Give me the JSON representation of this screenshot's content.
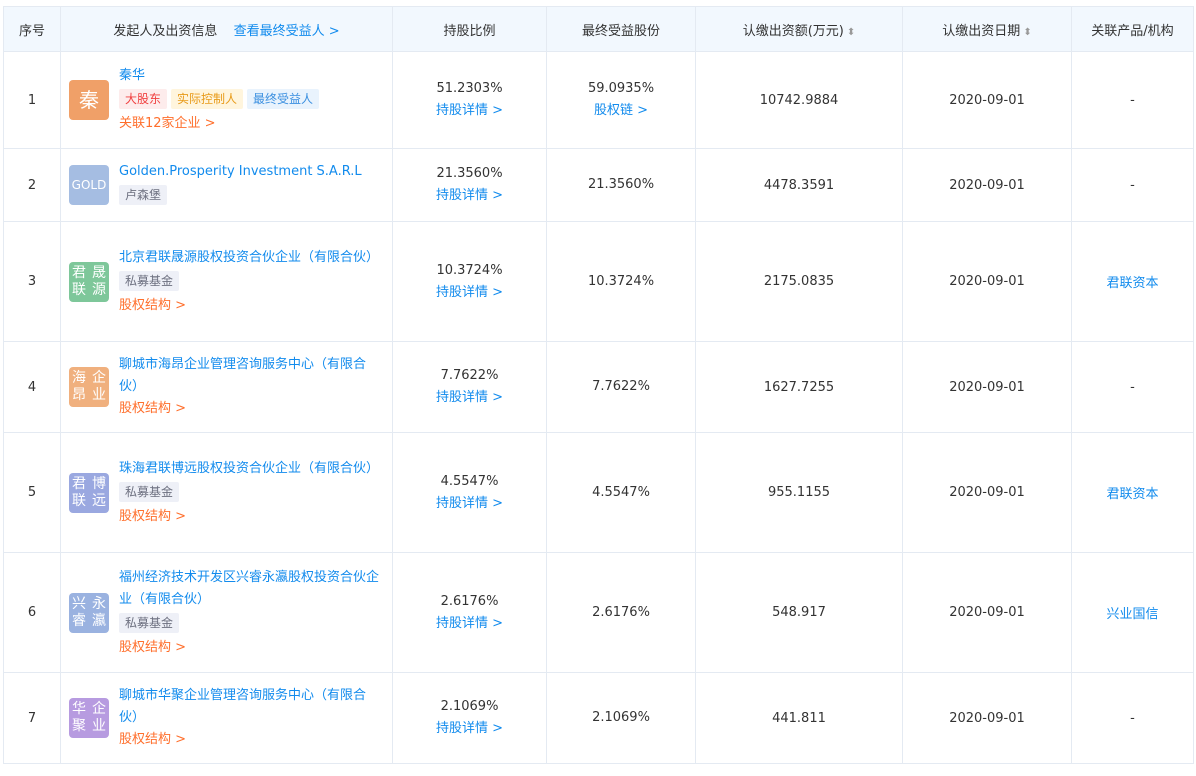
{
  "header": {
    "seq": "序号",
    "party": "发起人及出资信息",
    "view_beneficiary": "查看最终受益人 >",
    "ratio": "持股比例",
    "final_benefit": "最终受益股份",
    "amount": "认缴出资额(万元)",
    "date": "认缴出资日期",
    "related": "关联产品/机构"
  },
  "colors": {
    "link": "#128bed",
    "accent": "#ff6f2c",
    "header_bg": "#f2f8fe"
  },
  "rows": [
    {
      "seq": "1",
      "logo_text": "秦",
      "logo_color": "#f0a068",
      "name": "秦华",
      "tags": [
        {
          "text": "大股东",
          "style": "red"
        },
        {
          "text": "实际控制人",
          "style": "yellow"
        },
        {
          "text": "最终受益人",
          "style": "blue"
        }
      ],
      "extra_link": "关联12家企业 >",
      "ratio": "51.2303%",
      "ratio_link": "持股详情 >",
      "final_benefit": "59.0935%",
      "final_link": "股权链 >",
      "amount": "10742.9884",
      "date": "2020-09-01",
      "related": "-",
      "related_is_link": false
    },
    {
      "seq": "2",
      "logo_text": "GO LD",
      "logo_color": "#a5bde2",
      "name": "Golden.Prosperity Investment S.A.R.L",
      "tags": [
        {
          "text": "卢森堡",
          "style": "gray"
        }
      ],
      "extra_link": "",
      "ratio": "21.3560%",
      "ratio_link": "持股详情 >",
      "final_benefit": "21.3560%",
      "final_link": "",
      "amount": "4478.3591",
      "date": "2020-09-01",
      "related": "-",
      "related_is_link": false
    },
    {
      "seq": "3",
      "logo_text": "君联 晟源",
      "logo_color": "#7ec79a",
      "name": "北京君联晟源股权投资合伙企业（有限合伙）",
      "tags": [
        {
          "text": "私募基金",
          "style": "gray"
        }
      ],
      "extra_link": "股权结构 >",
      "ratio": "10.3724%",
      "ratio_link": "持股详情 >",
      "final_benefit": "10.3724%",
      "final_link": "",
      "amount": "2175.0835",
      "date": "2020-09-01",
      "related": "君联资本",
      "related_is_link": true
    },
    {
      "seq": "4",
      "logo_text": "海昂 企业",
      "logo_color": "#f0b07e",
      "name": "聊城市海昂企业管理咨询服务中心（有限合伙）",
      "tags": [],
      "extra_link": "股权结构 >",
      "ratio": "7.7622%",
      "ratio_link": "持股详情 >",
      "final_benefit": "7.7622%",
      "final_link": "",
      "amount": "1627.7255",
      "date": "2020-09-01",
      "related": "-",
      "related_is_link": false
    },
    {
      "seq": "5",
      "logo_text": "君联 博远",
      "logo_color": "#9aa8e0",
      "name": "珠海君联博远股权投资合伙企业（有限合伙）",
      "tags": [
        {
          "text": "私募基金",
          "style": "gray"
        }
      ],
      "extra_link": "股权结构 >",
      "ratio": "4.5547%",
      "ratio_link": "持股详情 >",
      "final_benefit": "4.5547%",
      "final_link": "",
      "amount": "955.1155",
      "date": "2020-09-01",
      "related": "君联资本",
      "related_is_link": true
    },
    {
      "seq": "6",
      "logo_text": "兴睿 永瀛",
      "logo_color": "#9ab2e0",
      "name": "福州经济技术开发区兴睿永瀛股权投资合伙企业（有限合伙）",
      "tags": [
        {
          "text": "私募基金",
          "style": "gray"
        }
      ],
      "extra_link": "股权结构 >",
      "ratio": "2.6176%",
      "ratio_link": "持股详情 >",
      "final_benefit": "2.6176%",
      "final_link": "",
      "amount": "548.917",
      "date": "2020-09-01",
      "related": "兴业国信",
      "related_is_link": true
    },
    {
      "seq": "7",
      "logo_text": "华聚 企业",
      "logo_color": "#b79be0",
      "name": "聊城市华聚企业管理咨询服务中心（有限合伙）",
      "tags": [],
      "extra_link": "股权结构 >",
      "ratio": "2.1069%",
      "ratio_link": "持股详情 >",
      "final_benefit": "2.1069%",
      "final_link": "",
      "amount": "441.811",
      "date": "2020-09-01",
      "related": "-",
      "related_is_link": false
    }
  ]
}
